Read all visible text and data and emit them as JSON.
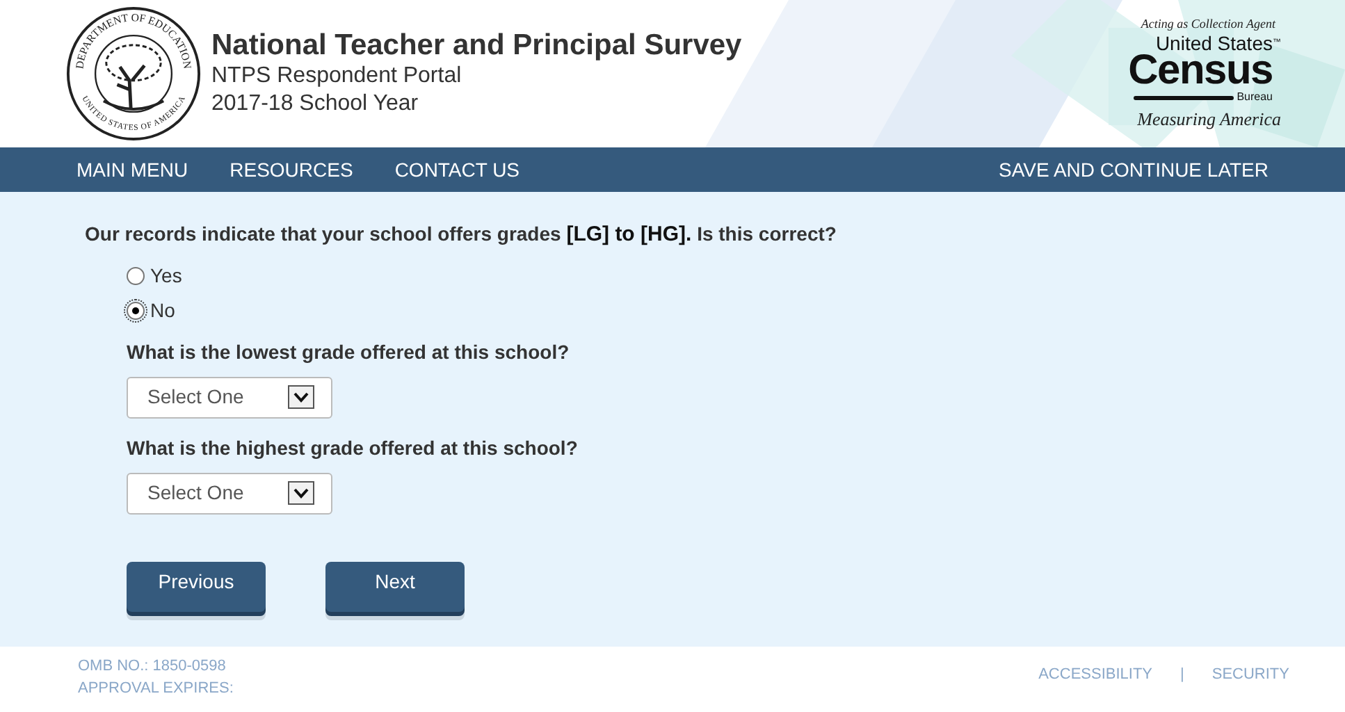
{
  "header": {
    "seal": {
      "top_text": "DEPARTMENT OF EDUCATION",
      "bottom_text": "UNITED STATES OF AMERICA"
    },
    "title": "National Teacher and Principal Survey",
    "subtitle": "NTPS Respondent Portal",
    "school_year": "2017-18 School Year",
    "census": {
      "tagline": "Acting as Collection Agent",
      "line1": "United States",
      "tm": "™",
      "name": "Census",
      "bureau": "Bureau",
      "slogan": "Measuring America"
    }
  },
  "nav": {
    "left": [
      "MAIN MENU",
      "RESOURCES",
      "CONTACT US"
    ],
    "right": "SAVE AND CONTINUE LATER"
  },
  "question": {
    "before": "Our records indicate that your school offers grades ",
    "emphasis": "[LG] to [HG].",
    "after": " Is this correct?"
  },
  "options": [
    {
      "label": "Yes",
      "selected": false
    },
    {
      "label": "No",
      "selected": true
    }
  ],
  "followups": [
    {
      "label": "What is the lowest grade offered at this school?",
      "placeholder": "Select One"
    },
    {
      "label": "What is the highest grade offered at this school?",
      "placeholder": "Select One"
    }
  ],
  "buttons": [
    "Previous",
    "Next"
  ],
  "footer": {
    "omb": "OMB NO.: 1850-0598",
    "expires": "APPROVAL EXPIRES:",
    "links": [
      "ACCESSIBILITY",
      "SECURITY"
    ],
    "separator": "|"
  }
}
